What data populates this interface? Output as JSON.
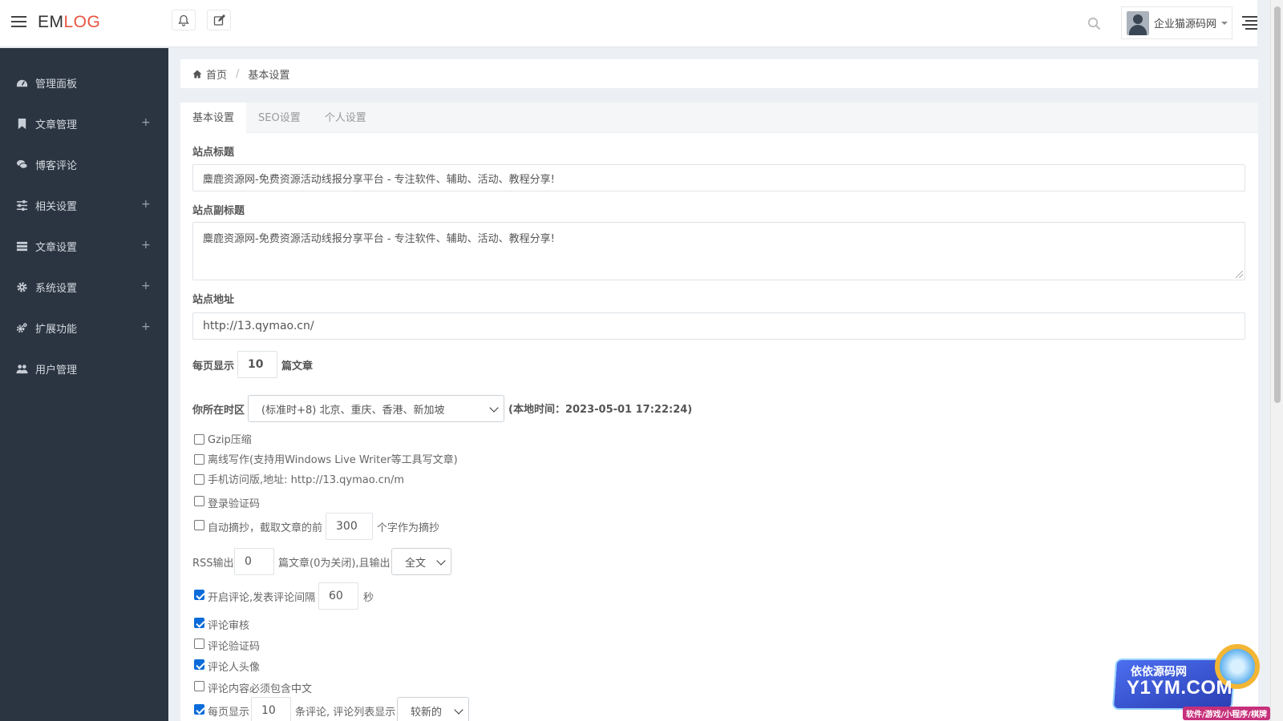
{
  "app": {
    "logo_em": "EM",
    "logo_log": "LOG"
  },
  "topbar": {
    "user_name": "企业猫源码网"
  },
  "sidebar": {
    "items": [
      {
        "label": "管理面板",
        "icon": "dashboard-icon",
        "expandable": false
      },
      {
        "label": "文章管理",
        "icon": "bookmark-icon",
        "expandable": true
      },
      {
        "label": "博客评论",
        "icon": "comments-icon",
        "expandable": false
      },
      {
        "label": "相关设置",
        "icon": "sliders-icon",
        "expandable": true
      },
      {
        "label": "文章设置",
        "icon": "list-icon",
        "expandable": true
      },
      {
        "label": "系统设置",
        "icon": "gear-icon",
        "expandable": true
      },
      {
        "label": "扩展功能",
        "icon": "gears-icon",
        "expandable": true
      },
      {
        "label": "用户管理",
        "icon": "users-icon",
        "expandable": false
      }
    ],
    "plus": "+"
  },
  "breadcrumb": {
    "home": "首页",
    "separator": "/",
    "current": "基本设置"
  },
  "tabs": [
    {
      "label": "基本设置",
      "active": true
    },
    {
      "label": "SEO设置",
      "active": false
    },
    {
      "label": "个人设置",
      "active": false
    }
  ],
  "form": {
    "site_title_label": "站点标题",
    "site_title_value": "麋鹿资源网-免费资源活动线报分享平台 - 专注软件、辅助、活动、教程分享!",
    "site_subtitle_label": "站点副标题",
    "site_subtitle_value": "麋鹿资源网-免费资源活动线报分享平台 - 专注软件、辅助、活动、教程分享!",
    "site_url_label": "站点地址",
    "site_url_value": "http://13.qymao.cn/",
    "per_page_prefix": "每页显示",
    "per_page_value": "10",
    "per_page_suffix": "篇文章",
    "timezone_label": "你所在时区",
    "timezone_value": "(标准时+8) 北京、重庆、香港、新加坡",
    "local_time": "(本地时间：2023-05-01 17:22:24)",
    "gzip_label": "Gzip压缩",
    "gzip_checked": false,
    "offline_label": "离线写作(支持用Windows Live Writer等工具写文章)",
    "offline_checked": false,
    "mobile_label": "手机访问版,地址: http://13.qymao.cn/m",
    "mobile_checked": false,
    "login_captcha_label": "登录验证码",
    "login_captcha_checked": false,
    "excerpt_prefix": "自动摘抄，截取文章的前",
    "excerpt_value": "300",
    "excerpt_suffix": "个字作为摘抄",
    "excerpt_checked": false,
    "rss_prefix": "RSS输出",
    "rss_value": "0",
    "rss_middle": "篇文章(0为关闭),且输出",
    "rss_select": "全文",
    "comment_open_prefix": "开启评论,发表评论间隔",
    "comment_interval": "60",
    "comment_interval_suffix": "秒",
    "comment_open_checked": true,
    "comment_review_label": "评论审核",
    "comment_review_checked": true,
    "comment_captcha_label": "评论验证码",
    "comment_captcha_checked": false,
    "comment_avatar_label": "评论人头像",
    "comment_avatar_checked": true,
    "comment_chinese_label": "评论内容必须包含中文",
    "comment_chinese_checked": false,
    "comment_page_prefix": "每页显示",
    "comment_page_value": "10",
    "comment_page_middle": "条评论, 评论列表显示",
    "comment_order_select": "较新的",
    "comment_page_checked": true
  },
  "watermark": {
    "line1": "依依源码网",
    "line2": "Y1YM.COM",
    "line3": "软件/游戏/小程序/棋牌"
  }
}
